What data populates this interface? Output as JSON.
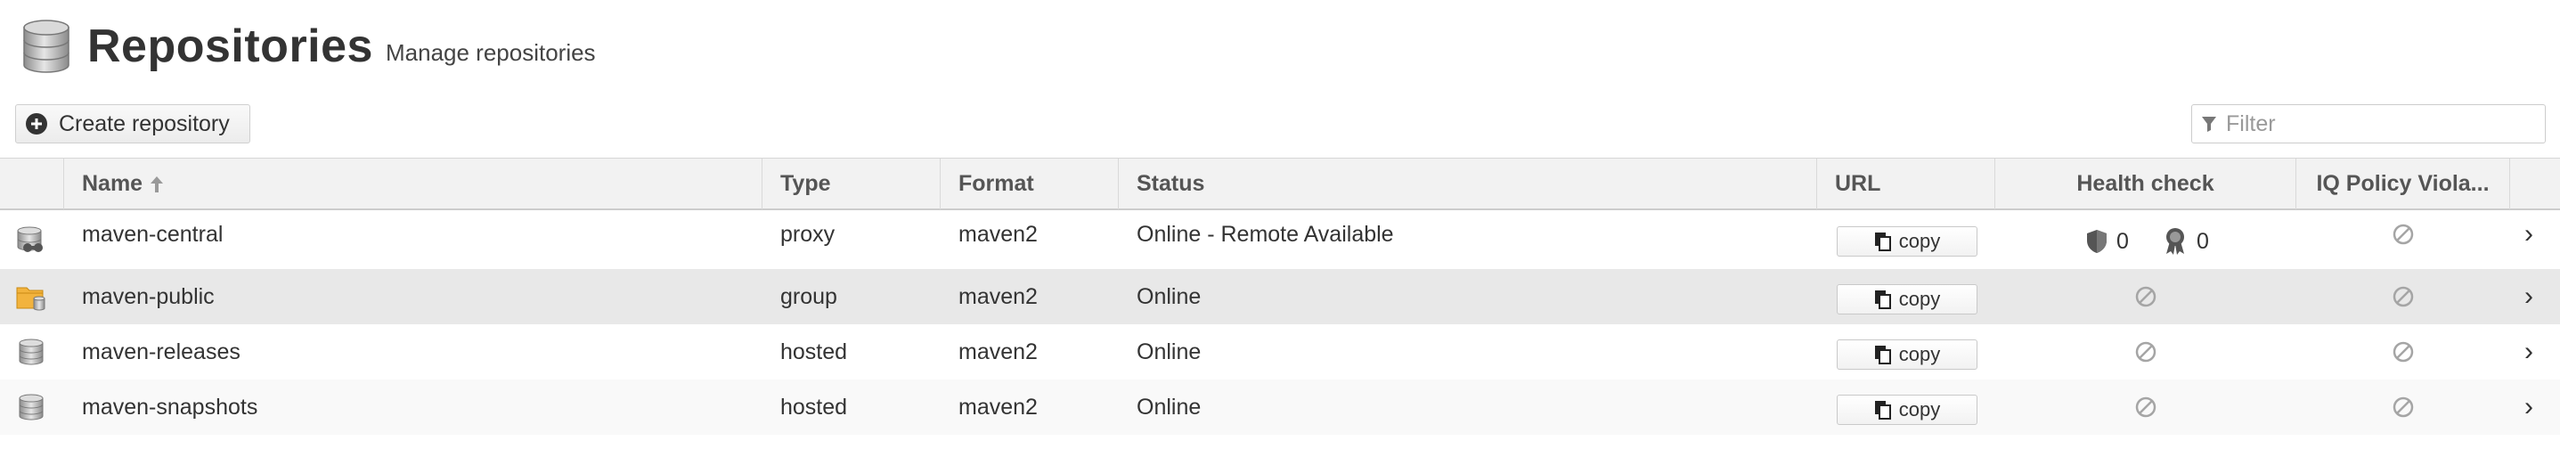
{
  "header": {
    "title": "Repositories",
    "subtitle": "Manage repositories",
    "icon": "database-icon"
  },
  "toolbar": {
    "create_label": "Create repository",
    "create_icon": "plus-circle-icon",
    "filter_placeholder": "Filter",
    "filter_icon": "funnel-icon"
  },
  "table": {
    "sort": {
      "column": "Name",
      "direction": "ascending"
    },
    "columns": [
      "Name",
      "Type",
      "Format",
      "Status",
      "URL",
      "Health check",
      "IQ Policy Viola..."
    ],
    "copy_label": "copy",
    "rows": [
      {
        "icon": "proxy-repository-icon",
        "name": "maven-central",
        "type": "proxy",
        "format": "maven2",
        "status": "Online - Remote Available",
        "health": {
          "security": "0",
          "license": "0"
        },
        "iq": "disabled"
      },
      {
        "icon": "group-repository-icon",
        "name": "maven-public",
        "type": "group",
        "format": "maven2",
        "status": "Online",
        "health": "disabled",
        "iq": "disabled"
      },
      {
        "icon": "hosted-repository-icon",
        "name": "maven-releases",
        "type": "hosted",
        "format": "maven2",
        "status": "Online",
        "health": "disabled",
        "iq": "disabled"
      },
      {
        "icon": "hosted-repository-icon",
        "name": "maven-snapshots",
        "type": "hosted",
        "format": "maven2",
        "status": "Online",
        "health": "disabled",
        "iq": "disabled"
      }
    ]
  },
  "colors": {
    "header_bg": "#f2f2f2",
    "row_alt_bg": "#f9f9f9",
    "row_selected_bg": "#e8e8e8",
    "text": "#333333",
    "muted_icon": "#a5a5a5"
  }
}
